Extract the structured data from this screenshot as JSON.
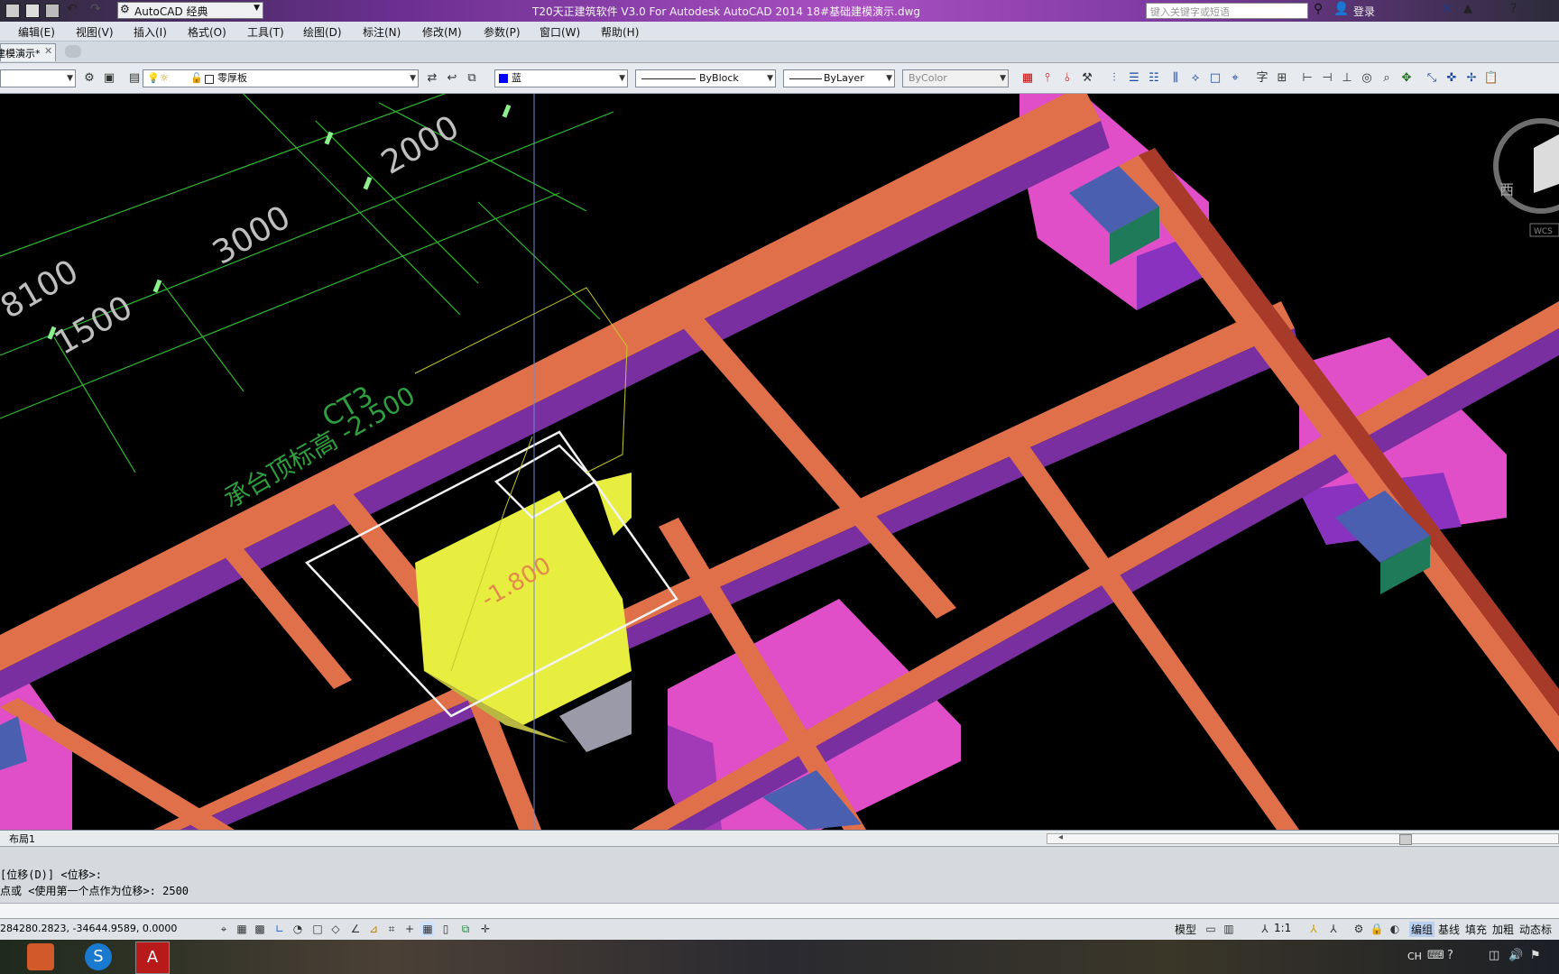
{
  "window": {
    "title": "T20天正建筑软件 V3.0 For Autodesk AutoCAD 2014    18#基础建模演示.dwg",
    "workspace": "AutoCAD 经典",
    "search_placeholder": "键入关键字或短语",
    "login": "登录"
  },
  "menu": [
    "编辑(E)",
    "视图(V)",
    "插入(I)",
    "格式(O)",
    "工具(T)",
    "绘图(D)",
    "标注(N)",
    "修改(M)",
    "参数(P)",
    "窗口(W)",
    "帮助(H)"
  ],
  "tabs": {
    "doc_tab": "建模演示*"
  },
  "toolbar": {
    "layer_name": "零厚板",
    "color": "蓝",
    "linetype": "ByBlock",
    "lineweight": "ByLayer",
    "plotstyle": "ByColor"
  },
  "drawing": {
    "dimensions": [
      "8100",
      "1500",
      "3000",
      "2000"
    ],
    "label_ct": "CT3",
    "label_elevation": "承台顶标高 -2.500",
    "label_inner": "-1.800",
    "viewcube_label": "西",
    "wcs": "WCS"
  },
  "layout": {
    "tab": "布局1"
  },
  "command": {
    "line1": "[位移(D)] <位移>:",
    "line2": "点或 <使用第一个点作为位移>: 2500"
  },
  "status": {
    "coords": "284280.2823, -34644.9589, 0.0000",
    "model": "模型",
    "scale": "1:1",
    "labels": [
      "编组",
      "基线",
      "填充",
      "加粗",
      "动态标注"
    ]
  },
  "taskbar": {
    "tray_text": "CH"
  },
  "colors": {
    "beam_top": "#e0704a",
    "beam_side": "#7a2fa0",
    "pile_cap": "#e04fc8",
    "column_top": "#4a5fb0",
    "selection": "#e8ee40",
    "dim_lines": "#2fb830"
  }
}
